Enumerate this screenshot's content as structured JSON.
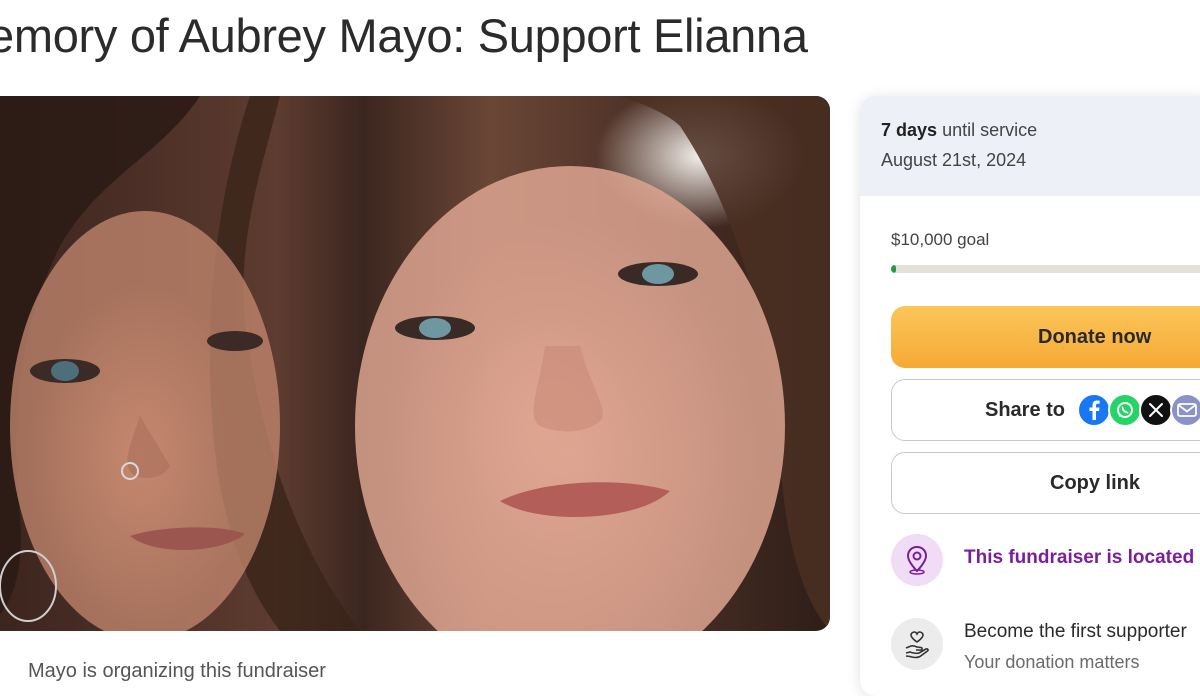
{
  "page": {
    "title": "emory of Aubrey Mayo: Support Elianna"
  },
  "hero": {
    "caption": "Mayo is organizing this fundraiser"
  },
  "sidebar": {
    "service": {
      "days": "7 days",
      "until": "until service",
      "date": "August 21st, 2024"
    },
    "goal_label": "$10,000 goal",
    "progress_fraction": 0.015,
    "donate_label": "Donate now",
    "share_label": "Share to",
    "share_icons": [
      "facebook-icon",
      "whatsapp-icon",
      "x-icon",
      "email-icon"
    ],
    "copy_label": "Copy link",
    "location_text": "This fundraiser is located in",
    "support_title": "Become the first supporter",
    "support_sub": "Your donation matters"
  },
  "colors": {
    "donate": "#f6a935",
    "progress": "#1f9a48",
    "location_text": "#7a1f9c",
    "facebook": "#1877f2",
    "whatsapp": "#25d366",
    "x": "#111111",
    "email": "#8a93c9"
  }
}
